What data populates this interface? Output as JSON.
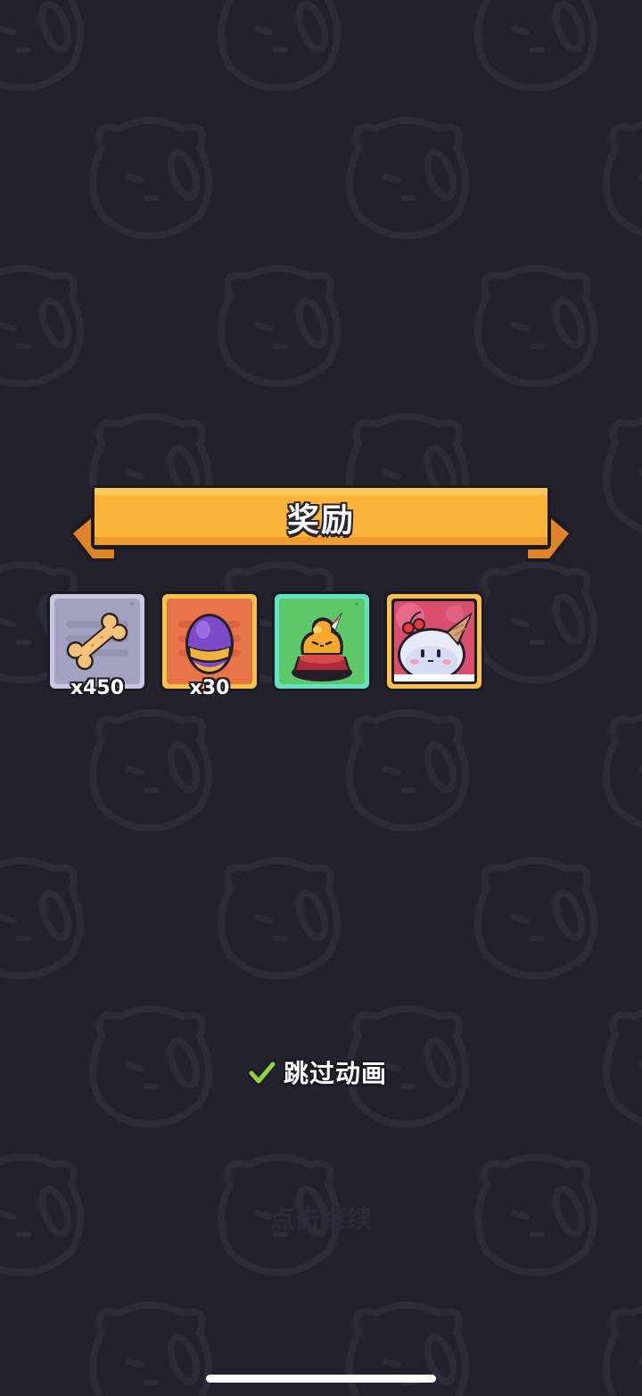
{
  "banner": {
    "title": "奖励"
  },
  "rewards": [
    {
      "name": "bone",
      "icon": "bone-icon",
      "count": "x450",
      "frame_color": "#a8a6c4"
    },
    {
      "name": "purple-egg",
      "icon": "egg-icon",
      "count": "x30",
      "frame_color": "#e8744a"
    },
    {
      "name": "pudding-slime-pet",
      "icon": "pudding-slime-icon",
      "count": "",
      "frame_color": "#5dd47c"
    },
    {
      "name": "icecream-slime-card",
      "icon": "icecream-slime-icon",
      "count": "",
      "frame_color": "#f7b53b"
    }
  ],
  "skip_animation": {
    "label": "跳过动画",
    "checked": true
  },
  "tap_to_continue": {
    "label": "点击继续"
  },
  "colors": {
    "background": "#22212c",
    "banner": "#fdb43a",
    "banner_ribbon": "#e0842c",
    "check": "#8fd23a"
  }
}
